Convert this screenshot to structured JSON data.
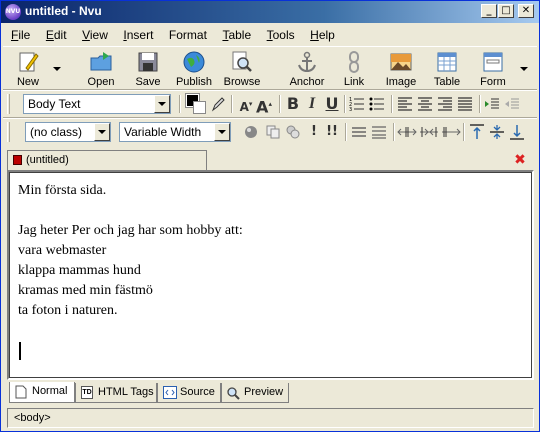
{
  "window": {
    "title": "untitled - Nvu",
    "app_icon_text": "NVU",
    "minimize": "_",
    "maximize": "□",
    "close": "✕"
  },
  "menubar": {
    "items": [
      {
        "key": "F",
        "rest": "ile"
      },
      {
        "key": "E",
        "rest": "dit"
      },
      {
        "key": "V",
        "rest": "iew"
      },
      {
        "key": "I",
        "rest": "nsert"
      },
      {
        "key": "",
        "pre": "F",
        "rest": "ormat"
      },
      {
        "key": "T",
        "rest": "able"
      },
      {
        "key": "T",
        "rest": "ools"
      },
      {
        "key": "H",
        "rest": "elp"
      }
    ]
  },
  "composition_toolbar": {
    "new": "New",
    "open": "Open",
    "save": "Save",
    "publish": "Publish",
    "browse": "Browse",
    "anchor": "Anchor",
    "link": "Link",
    "image": "Image",
    "table": "Table",
    "form": "Form"
  },
  "format_toolbar": {
    "paragraph_format": "Body Text",
    "class": "(no class)",
    "font": "Variable Width",
    "bold": "B",
    "italic": "I",
    "underline": "U",
    "smaller_text": "A",
    "larger_text": "A"
  },
  "document_tab": {
    "label": "(untitled)"
  },
  "editor": {
    "lines": [
      "Min första sida.",
      "",
      "Jag heter Per och jag har som hobby att:",
      "vara webmaster",
      "klappa mammas hund",
      "kramas med min fästmö",
      "ta foton i naturen."
    ]
  },
  "view_tabs": {
    "normal": "Normal",
    "html_tags": "HTML Tags",
    "source": "Source",
    "preview": "Preview",
    "html_tags_icon_text": "TD"
  },
  "statusbar": {
    "tag": "<body>"
  },
  "colors": {
    "titlebar_start": "#0a246a",
    "titlebar_end": "#a6caf0",
    "chrome": "#ece9d8"
  }
}
